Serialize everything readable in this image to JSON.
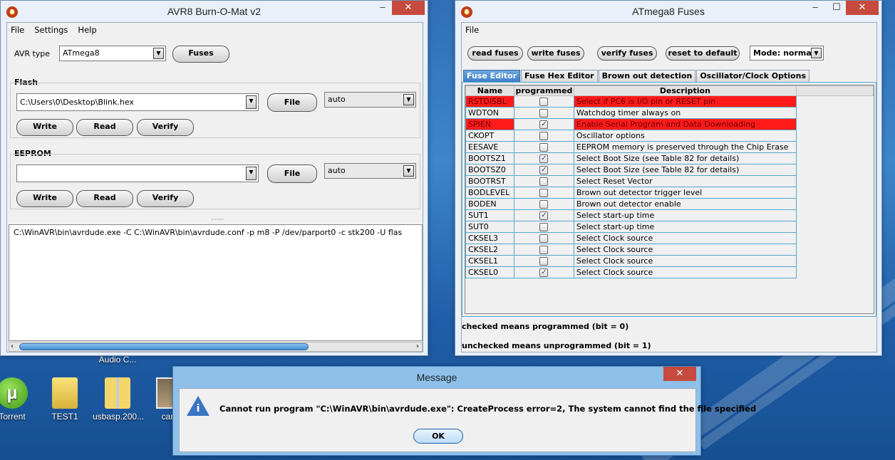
{
  "burnomat": {
    "title": "AVR8 Burn-O-Mat v2",
    "menu": [
      "File",
      "Settings",
      "Help"
    ],
    "avr_type_label": "AVR type",
    "avr_type_value": "ATmega8",
    "fuses_button": "Fuses",
    "flash": {
      "label": "Flash",
      "file_value": "C:\\Users\\0\\Desktop\\Blink.hex",
      "file_button": "File",
      "format": "auto",
      "write": "Write",
      "read": "Read",
      "verify": "Verify"
    },
    "eeprom": {
      "label": "EEPROM",
      "file_value": "",
      "file_button": "File",
      "format": "auto",
      "write": "Write",
      "read": "Read",
      "verify": "Verify"
    },
    "output_text": "C:\\WinAVR\\bin\\avrdude.exe -C C:\\WinAVR\\bin\\avrdude.conf -p m8 -P /dev/parport0 -c stk200  -U flas"
  },
  "fuses": {
    "title": "ATmega8 Fuses",
    "menu": [
      "File"
    ],
    "buttons": {
      "read": "read fuses",
      "write": "write fuses",
      "verify": "verify fuses",
      "reset": "reset to default"
    },
    "mode": "Mode: normal",
    "tabs": [
      "Fuse Editor",
      "Fuse Hex Editor",
      "Brown out detection",
      "Oscillator/Clock Options"
    ],
    "columns": [
      "Name",
      "programmed",
      "Description"
    ],
    "rows": [
      {
        "name": "RSTDISBL",
        "checked": false,
        "desc": "Select if PC6 is I/O pin or RESET pin",
        "warn": true
      },
      {
        "name": "WDTON",
        "checked": false,
        "desc": "Watchdog timer always on",
        "warn": false
      },
      {
        "name": "SPIEN",
        "checked": true,
        "desc": "Enable Serial Program and Data Downloading",
        "warn": true
      },
      {
        "name": "CKOPT",
        "checked": false,
        "desc": "Oscillator options",
        "warn": false
      },
      {
        "name": "EESAVE",
        "checked": false,
        "desc": "EEPROM memory is preserved through the Chip Erase",
        "warn": false
      },
      {
        "name": "BOOTSZ1",
        "checked": true,
        "desc": "Select Boot Size (see Table 82 for details)",
        "warn": false
      },
      {
        "name": "BOOTSZ0",
        "checked": true,
        "desc": "Select Boot Size (see Table 82 for details)",
        "warn": false
      },
      {
        "name": "BOOTRST",
        "checked": false,
        "desc": "Select Reset Vector",
        "warn": false
      },
      {
        "name": "BODLEVEL",
        "checked": false,
        "desc": "Brown out detector trigger level",
        "warn": false
      },
      {
        "name": "BODEN",
        "checked": false,
        "desc": "Brown out detector enable",
        "warn": false
      },
      {
        "name": "SUT1",
        "checked": true,
        "desc": "Select start-up time",
        "warn": false
      },
      {
        "name": "SUT0",
        "checked": false,
        "desc": "Select start-up time",
        "warn": false
      },
      {
        "name": "CKSEL3",
        "checked": false,
        "desc": "Select Clock source",
        "warn": false
      },
      {
        "name": "CKSEL2",
        "checked": false,
        "desc": "Select Clock source",
        "warn": false
      },
      {
        "name": "CKSEL1",
        "checked": false,
        "desc": "Select Clock source",
        "warn": false
      },
      {
        "name": "CKSEL0",
        "checked": true,
        "desc": "Select Clock source",
        "warn": false
      }
    ],
    "note_checked": "checked means programmed (bit = 0)",
    "note_unchecked": "unchecked means unprogrammed (bit = 1)"
  },
  "message": {
    "title": "Message",
    "text": "Cannot run program \"C:\\WinAVR\\bin\\avrdude.exe\": CreateProcess error=2, The system cannot find the file specified",
    "ok": "OK"
  },
  "desktop": {
    "partial_label": "Audio C...",
    "icons": [
      "Torrent",
      "TEST1",
      "usbasp.200...",
      "car"
    ]
  },
  "colors": {
    "warn_row": "#ff1a1a",
    "accent": "#3c7fc7"
  }
}
